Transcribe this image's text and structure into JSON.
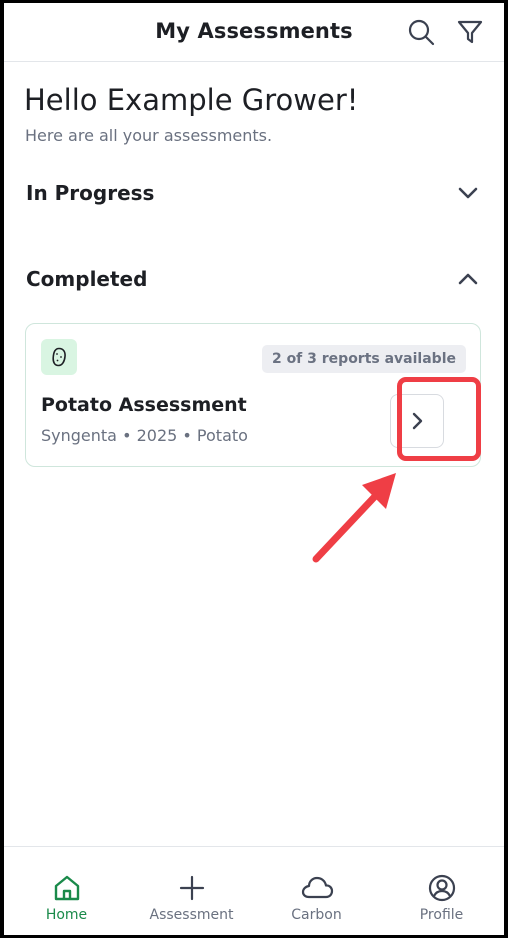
{
  "header": {
    "title": "My Assessments",
    "search_icon": "search-icon",
    "filter_icon": "filter-icon"
  },
  "greeting": {
    "title": "Hello Example Grower!",
    "subtitle": "Here are all your assessments."
  },
  "sections": {
    "in_progress": {
      "label": "In Progress",
      "expanded": false
    },
    "completed": {
      "label": "Completed",
      "expanded": true
    }
  },
  "completed_items": [
    {
      "icon": "potato-icon",
      "badge": "2 of 3 reports available",
      "title": "Potato Assessment",
      "meta": "Syngenta • 2025 • Potato"
    }
  ],
  "bottom_nav": [
    {
      "label": "Home",
      "icon": "home-icon",
      "active": true
    },
    {
      "label": "Assessment",
      "icon": "plus-icon",
      "active": false
    },
    {
      "label": "Carbon",
      "icon": "cloud-icon",
      "active": false
    },
    {
      "label": "Profile",
      "icon": "profile-icon",
      "active": false
    }
  ],
  "colors": {
    "accent_green": "#1a8a4a",
    "highlight_red": "#ef3e45",
    "text_dark": "#1d1f24",
    "text_muted": "#6a7180"
  }
}
